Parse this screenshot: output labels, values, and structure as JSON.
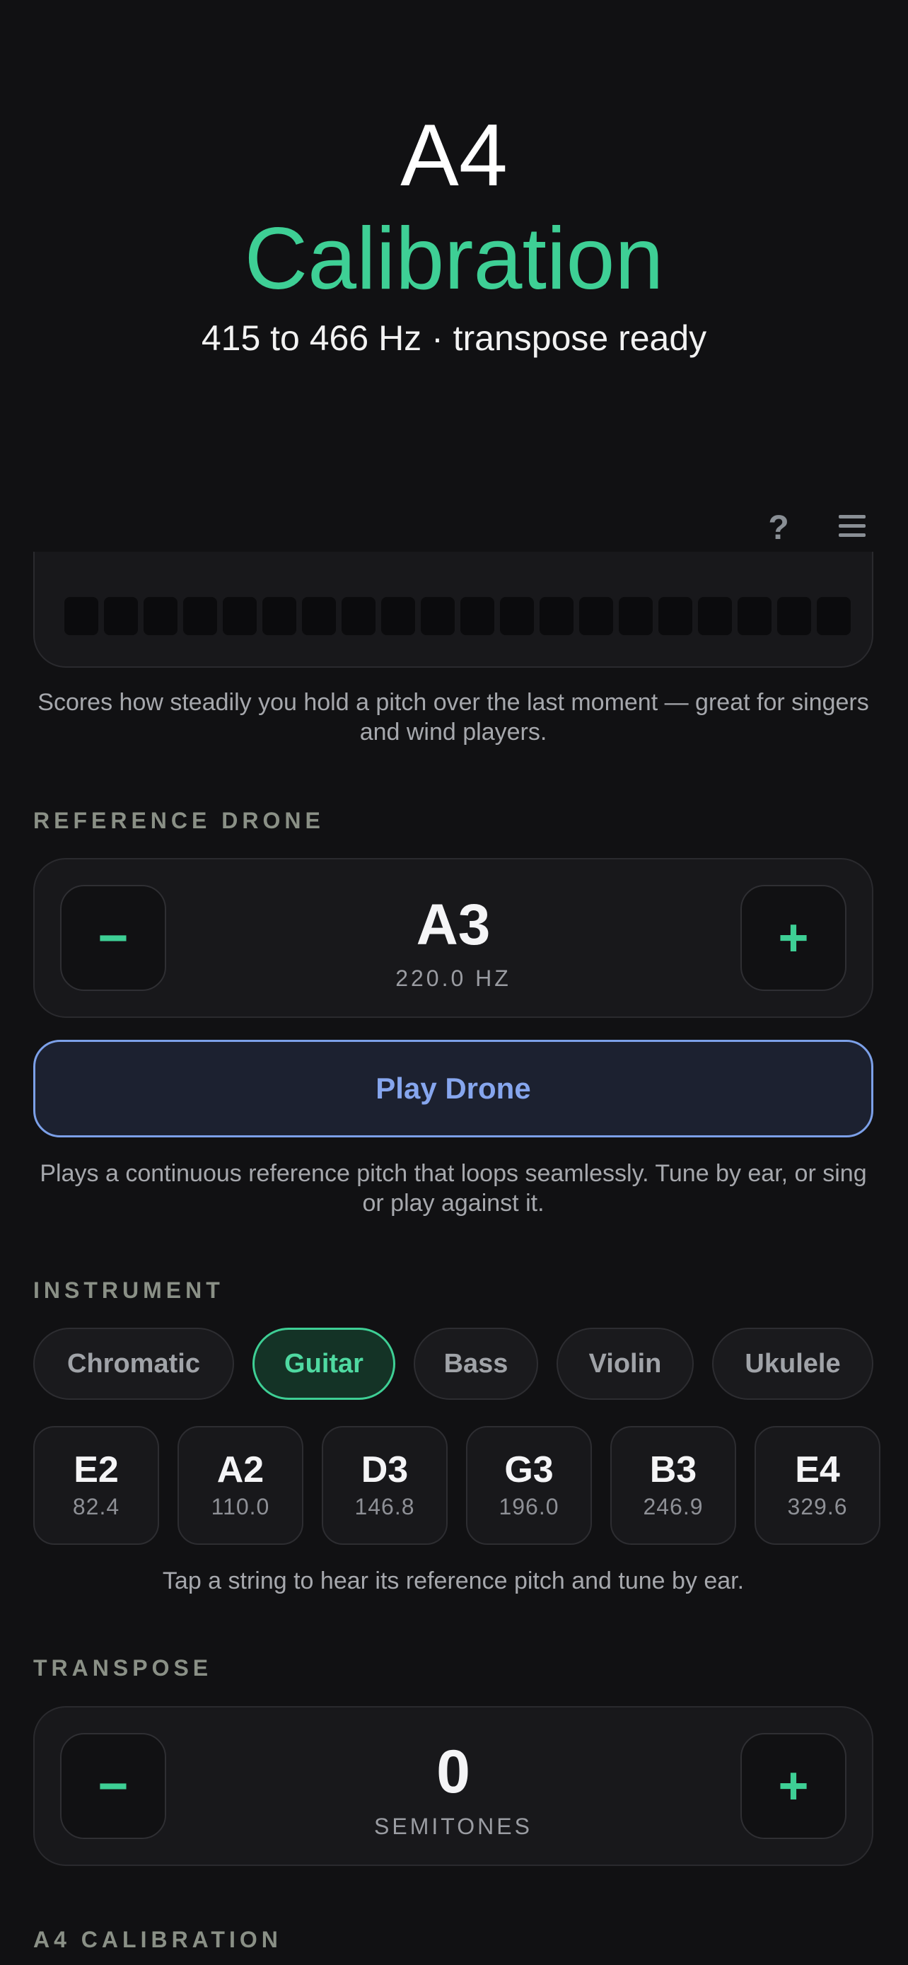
{
  "hero": {
    "title": "A4",
    "subtitle": "Calibration",
    "description": "415 to 466 Hz · transpose ready"
  },
  "topbar": {
    "help_label": "?",
    "help_icon": "question-mark-icon",
    "menu_icon": "hamburger-menu-icon"
  },
  "stability": {
    "note": "Scores how steadily you hold a pitch over the last moment — great for singers and wind players."
  },
  "drone": {
    "section_label": "REFERENCE DRONE",
    "minus_label": "−",
    "plus_label": "+",
    "note": "A3",
    "frequency": "220.0 HZ",
    "play_label": "Play Drone",
    "description": "Plays a continuous reference pitch that loops seamlessly. Tune by ear, or sing or play against it."
  },
  "instrument": {
    "section_label": "INSTRUMENT",
    "chips": [
      "Chromatic",
      "Guitar",
      "Bass",
      "Violin",
      "Ukulele"
    ],
    "selected": "Guitar",
    "strings": [
      {
        "note": "E2",
        "freq": "82.4"
      },
      {
        "note": "A2",
        "freq": "110.0"
      },
      {
        "note": "D3",
        "freq": "146.8"
      },
      {
        "note": "G3",
        "freq": "196.0"
      },
      {
        "note": "B3",
        "freq": "246.9"
      },
      {
        "note": "E4",
        "freq": "329.6"
      }
    ],
    "hint": "Tap a string to hear its reference pitch and tune by ear."
  },
  "transpose": {
    "section_label": "TRANSPOSE",
    "minus_label": "−",
    "plus_label": "+",
    "value": "0",
    "unit": "SEMITONES"
  },
  "calibration": {
    "section_label": "A4 CALIBRATION"
  },
  "colors": {
    "accent": "#3ecf95",
    "drone_button": "#86a6ee",
    "background": "#111113"
  }
}
